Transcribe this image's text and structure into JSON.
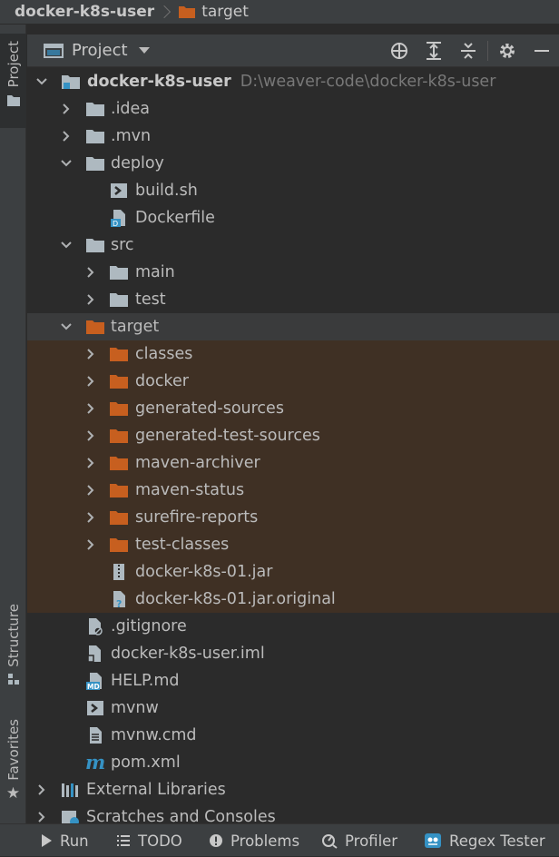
{
  "breadcrumb": {
    "root": "docker-k8s-user",
    "current": "target",
    "current_icon": "folder-orange-icon"
  },
  "left_strip": {
    "project": "Project",
    "structure": "Structure",
    "favorites": "Favorites"
  },
  "project_panel": {
    "title": "Project"
  },
  "colors": {
    "excluded_folder": "#c75f1f",
    "folder": "#aeb9c0",
    "excluded_bg": "#3f3024",
    "module_accent": "#3592c4"
  },
  "tree": {
    "root": {
      "label": "docker-k8s-user",
      "path": "D:\\weaver-code\\docker-k8s-user"
    },
    "idea": ".idea",
    "mvn": ".mvn",
    "deploy": "deploy",
    "build_sh": "build.sh",
    "dockerfile": "Dockerfile",
    "src": "src",
    "main": "main",
    "test": "test",
    "target": "target",
    "classes": "classes",
    "docker": "docker",
    "generated_sources": "generated-sources",
    "generated_test_sources": "generated-test-sources",
    "maven_archiver": "maven-archiver",
    "maven_status": "maven-status",
    "surefire_reports": "surefire-reports",
    "test_classes": "test-classes",
    "jar": "docker-k8s-01.jar",
    "jar_original": "docker-k8s-01.jar.original",
    "gitignore": ".gitignore",
    "iml": "docker-k8s-user.iml",
    "help_md": "HELP.md",
    "mvnw": "mvnw",
    "mvnw_cmd": "mvnw.cmd",
    "pom": "pom.xml",
    "external_libraries": "External Libraries",
    "scratches": "Scratches and Consoles"
  },
  "bottom_bar": {
    "run": "Run",
    "todo": "TODO",
    "problems": "Problems",
    "profiler": "Profiler",
    "regex_tester": "Regex Tester"
  }
}
